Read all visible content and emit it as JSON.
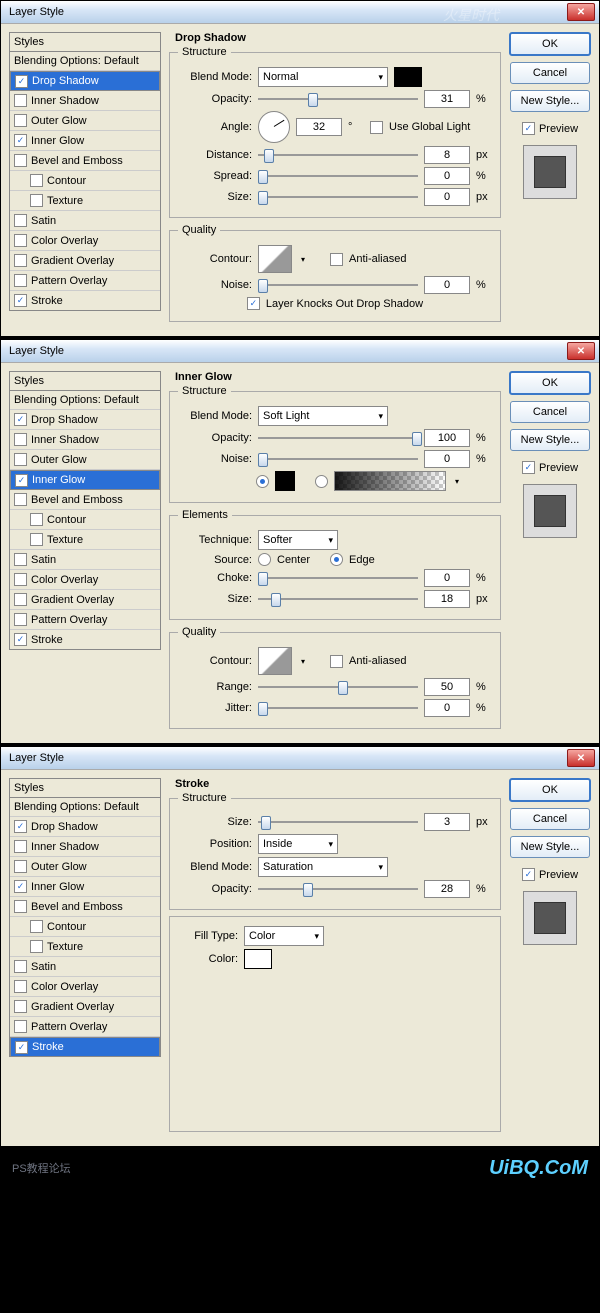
{
  "common": {
    "windowTitle": "Layer Style",
    "stylesHeader": "Styles",
    "blendingOptions": "Blending Options: Default",
    "ok": "OK",
    "cancel": "Cancel",
    "newStyle": "New Style...",
    "preview": "Preview",
    "items": {
      "dropShadow": "Drop Shadow",
      "innerShadow": "Inner Shadow",
      "outerGlow": "Outer Glow",
      "innerGlow": "Inner Glow",
      "bevel": "Bevel and Emboss",
      "contour": "Contour",
      "texture": "Texture",
      "satin": "Satin",
      "colorOverlay": "Color Overlay",
      "gradientOverlay": "Gradient Overlay",
      "patternOverlay": "Pattern Overlay",
      "stroke": "Stroke"
    },
    "labels": {
      "structure": "Structure",
      "quality": "Quality",
      "elements": "Elements",
      "blendMode": "Blend Mode:",
      "opacity": "Opacity:",
      "angle": "Angle:",
      "useGlobal": "Use Global Light",
      "distance": "Distance:",
      "spread": "Spread:",
      "size": "Size:",
      "contour": "Contour:",
      "noise": "Noise:",
      "antiAliased": "Anti-aliased",
      "knocks": "Layer Knocks Out Drop Shadow",
      "technique": "Technique:",
      "source": "Source:",
      "center": "Center",
      "edge": "Edge",
      "choke": "Choke:",
      "range": "Range:",
      "jitter": "Jitter:",
      "position": "Position:",
      "fillType": "Fill Type:",
      "color": "Color:"
    },
    "units": {
      "pct": "%",
      "px": "px",
      "deg": "°"
    }
  },
  "d1": {
    "title": "Drop Shadow",
    "checked": {
      "dropShadow": true,
      "innerGlow": true,
      "stroke": true
    },
    "blendMode": "Normal",
    "opacity": "31",
    "angle": "32",
    "distance": "8",
    "spread": "0",
    "size": "0",
    "noise": "0",
    "useGlobal": false,
    "antiAliased": false,
    "knocks": true
  },
  "d2": {
    "title": "Inner Glow",
    "checked": {
      "dropShadow": true,
      "innerGlow": true,
      "stroke": true
    },
    "blendMode": "Soft Light",
    "opacity": "100",
    "noise": "0",
    "colorMode": "solid",
    "technique": "Softer",
    "source": "edge",
    "choke": "0",
    "size": "18",
    "antiAliased": false,
    "range": "50",
    "jitter": "0"
  },
  "d3": {
    "title": "Stroke",
    "checked": {
      "dropShadow": true,
      "innerGlow": true,
      "stroke": true
    },
    "size": "3",
    "position": "Inside",
    "blendMode": "Saturation",
    "opacity": "28",
    "fillType": "Color",
    "color": "#ffffff"
  },
  "footer": {
    "left": "PS教程论坛",
    "right": "UiBQ.CoM"
  },
  "watermark": "火星时代"
}
